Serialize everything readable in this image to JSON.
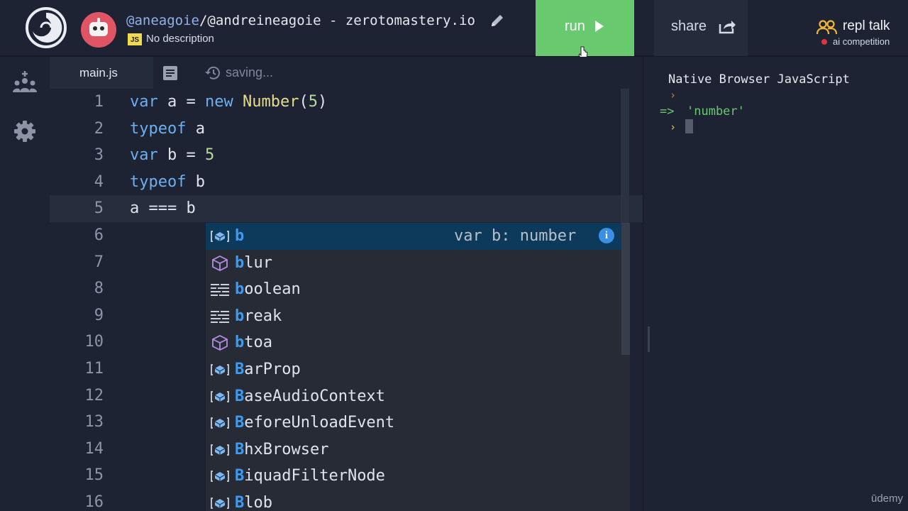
{
  "header": {
    "owner": "@aneagoie",
    "title_rest": "/@andreineagoie - zerotomastery.io",
    "language_badge": "JS",
    "description": "No description",
    "run_label": "run",
    "share_label": "share",
    "talk_label": "repl talk",
    "talk_sub": "ai competition"
  },
  "tabs": {
    "file": "main.js",
    "status": "saving..."
  },
  "editor": {
    "line_numbers": [
      "1",
      "2",
      "3",
      "4",
      "5",
      "6",
      "7",
      "8",
      "9",
      "10",
      "11",
      "12",
      "13",
      "14",
      "15",
      "16"
    ],
    "active_line": 5,
    "lines": [
      "var a = new Number(5)",
      "typeof a",
      "var b = 5",
      "typeof b",
      "a === b"
    ]
  },
  "autocomplete": {
    "items": [
      {
        "match": "b",
        "rest": "",
        "icon": "variable-icon",
        "detail": "var b: number"
      },
      {
        "match": "b",
        "rest": "lur",
        "icon": "method-cube-icon"
      },
      {
        "match": "b",
        "rest": "oolean",
        "icon": "keyword-icon"
      },
      {
        "match": "b",
        "rest": "reak",
        "icon": "keyword-icon"
      },
      {
        "match": "b",
        "rest": "toa",
        "icon": "method-cube-icon"
      },
      {
        "match": "B",
        "rest": "arProp",
        "icon": "variable-icon"
      },
      {
        "match": "B",
        "rest": "aseAudioContext",
        "icon": "variable-icon"
      },
      {
        "match": "B",
        "rest": "eforeUnloadEvent",
        "icon": "variable-icon"
      },
      {
        "match": "B",
        "rest": "hxBrowser",
        "icon": "variable-icon"
      },
      {
        "match": "B",
        "rest": "iquadFilterNode",
        "icon": "variable-icon"
      },
      {
        "match": "B",
        "rest": "lob",
        "icon": "variable-icon"
      }
    ],
    "info_glyph": "i"
  },
  "console": {
    "header": "Native Browser JavaScript",
    "arrow": "=>",
    "result": "'number'"
  },
  "watermark": "ūdemy",
  "colors": {
    "run": "#68c96f",
    "keyword": "#6cb0ef",
    "match": "#3f9af0",
    "selected": "#0d3a5a"
  }
}
